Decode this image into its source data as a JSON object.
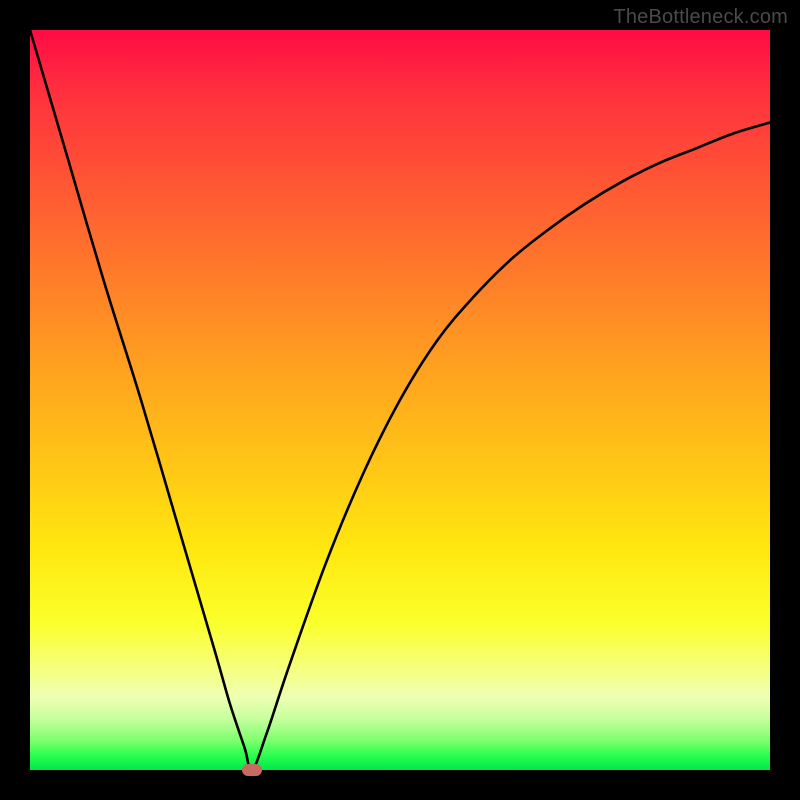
{
  "watermark": "TheBottleneck.com",
  "accent_marker_color": "#c76a61",
  "chart_data": {
    "type": "line",
    "title": "",
    "xlabel": "",
    "ylabel": "",
    "xlim": [
      0,
      100
    ],
    "ylim": [
      0,
      100
    ],
    "series": [
      {
        "name": "bottleneck-curve",
        "x": [
          0,
          5,
          10,
          15,
          20,
          25,
          27,
          29,
          30,
          32,
          35,
          40,
          45,
          50,
          55,
          60,
          65,
          70,
          75,
          80,
          85,
          90,
          95,
          100
        ],
        "y": [
          100,
          83,
          66,
          50,
          33,
          16,
          9,
          3,
          0,
          5,
          14,
          28,
          40,
          50,
          58,
          64,
          69,
          73,
          76.5,
          79.5,
          82,
          84,
          86,
          87.5
        ]
      }
    ],
    "marker": {
      "x": 30,
      "y": 0
    },
    "gradient_stops": [
      {
        "pos": 0,
        "color": "#ff0b45"
      },
      {
        "pos": 22,
        "color": "#ff5a33"
      },
      {
        "pos": 46,
        "color": "#ffa21f"
      },
      {
        "pos": 70,
        "color": "#ffe70f"
      },
      {
        "pos": 90,
        "color": "#efffb3"
      },
      {
        "pos": 100,
        "color": "#00e84a"
      }
    ]
  }
}
